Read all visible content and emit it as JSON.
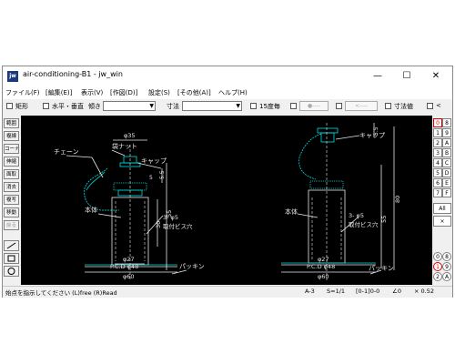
{
  "window": {
    "title": "air-conditioning-B1 - jw_win",
    "app_icon_text": "jw",
    "controls": {
      "minimize": "—",
      "maximize": "☐",
      "close": "✕"
    }
  },
  "menu": [
    "ファイル(F)",
    "[編集(E)]",
    "表示(V)",
    "[作図(D)]",
    "設定(S)",
    "[その他(A)]",
    "ヘルプ(H)"
  ],
  "toolbar": {
    "rect_label": "矩形",
    "hv_label": "水平・垂直",
    "tilt_label": "傾き",
    "dim_label": "寸法",
    "deg15_label": "15度毎",
    "btn1_label": "●----",
    "btn2_label": "<----",
    "dimval_label": "寸法値",
    "last_label": "<"
  },
  "left_tools": [
    "範囲",
    "複線",
    "コーナー",
    "伸縮",
    "面取",
    "消去",
    "複写",
    "移動",
    "戻る"
  ],
  "right_tools": {
    "col1": [
      "0",
      "1",
      "2",
      "3",
      "4",
      "5",
      "6",
      "7",
      "All",
      "×",
      "0",
      "1",
      "2"
    ],
    "col2": [
      "8",
      "9",
      "A",
      "B",
      "C",
      "D",
      "E",
      "F",
      "",
      "",
      "8",
      "9",
      "A"
    ]
  },
  "drawing": {
    "left": {
      "chain": "チェーン",
      "nut": "袋ナット",
      "cap": "キャップ",
      "body": "本体",
      "holes": "3- φ5",
      "screw_hole": "取付ビス穴",
      "packing": "パッキン",
      "phi35": "φ35",
      "phi27": "φ27",
      "pcd": "P.C.D φ48",
      "phi60": "φ60",
      "d55": "55",
      "d30": "30",
      "d5_5": "5.5",
      "d5": "5"
    },
    "right": {
      "cap": "キャップ",
      "body": "本体",
      "holes": "3- φ5",
      "screw_hole": "取付ビス穴",
      "packing": "パッキン",
      "phi27": "φ27",
      "pcd": "P.C.D φ48",
      "phi60": "φ60",
      "d80": "80",
      "d55": "55",
      "d5_5": "5.5"
    }
  },
  "status": {
    "message": "始点を指示してください (L)free (R)Read",
    "layer": "A-3",
    "scale": "S=1/1",
    "group": "[0-1]0-0",
    "angle": "∠0",
    "zoom": "× 0.52"
  }
}
